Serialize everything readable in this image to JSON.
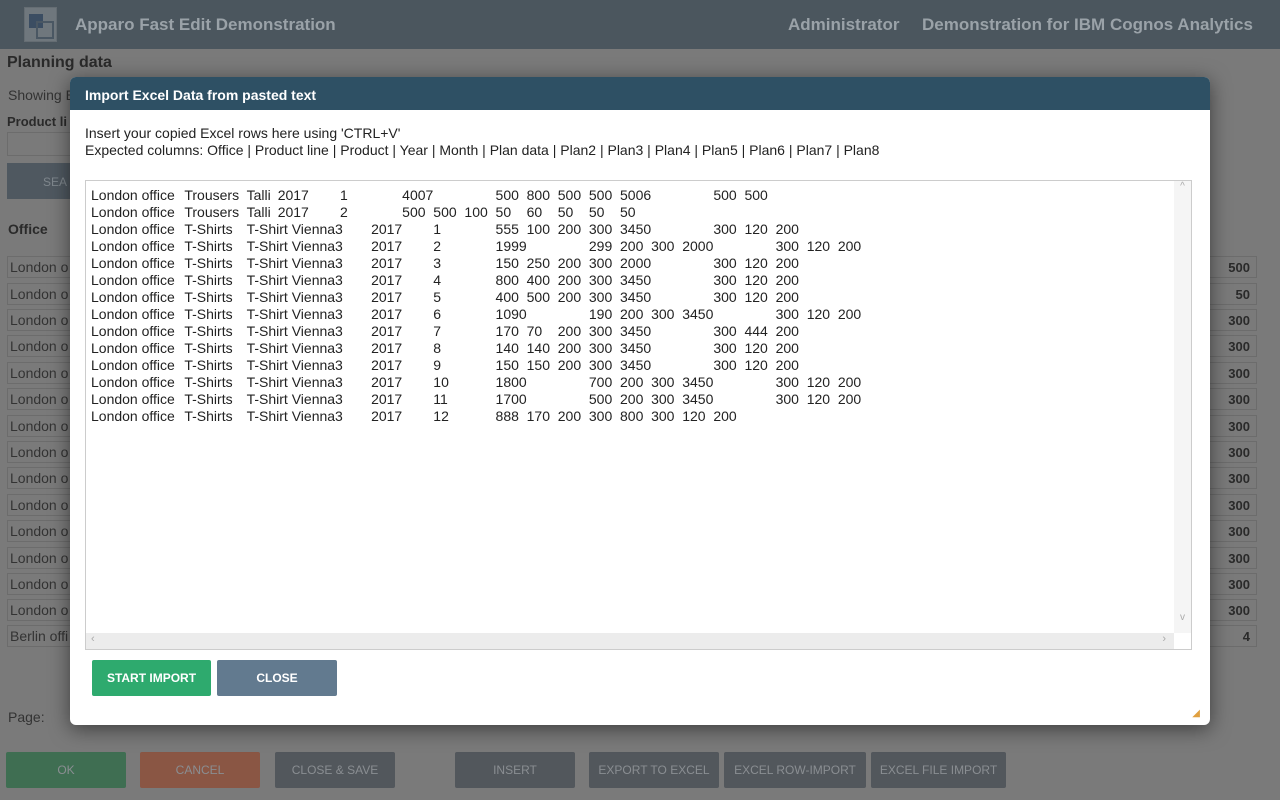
{
  "header": {
    "title": "Apparo Fast Edit Demonstration",
    "user": "Administrator",
    "context": "Demonstration for IBM Cognos Analytics"
  },
  "page": {
    "title": "Planning data",
    "showing": "Showing E",
    "product_line_label": "Product li",
    "search_label": "SEA",
    "office_header": "Office",
    "page_label": "Page:"
  },
  "rows": [
    {
      "office": "London o",
      "value": "500"
    },
    {
      "office": "London o",
      "value": "50"
    },
    {
      "office": "London o",
      "value": "300"
    },
    {
      "office": "London o",
      "value": "300"
    },
    {
      "office": "London o",
      "value": "300"
    },
    {
      "office": "London o",
      "value": "300"
    },
    {
      "office": "London o",
      "value": "300"
    },
    {
      "office": "London o",
      "value": "300"
    },
    {
      "office": "London o",
      "value": "300"
    },
    {
      "office": "London o",
      "value": "300"
    },
    {
      "office": "London o",
      "value": "300"
    },
    {
      "office": "London o",
      "value": "300"
    },
    {
      "office": "London o",
      "value": "300"
    },
    {
      "office": "London o",
      "value": "300"
    },
    {
      "office": "Berlin offi",
      "value": "4"
    }
  ],
  "bottom_buttons": {
    "ok": "OK",
    "cancel": "CANCEL",
    "close_save": "CLOSE & SAVE",
    "insert": "INSERT",
    "export": "EXPORT TO EXCEL",
    "row_import": "EXCEL ROW-IMPORT",
    "file_import": "EXCEL FILE IMPORT"
  },
  "colors": {
    "start": "#2eaa6e",
    "close": "#627a8f",
    "modal_header": "#2e5064"
  },
  "modal": {
    "title": "Import Excel Data from pasted text",
    "instruction": "Insert your copied Excel rows here using 'CTRL+V'",
    "expected": "Expected columns: Office | Product line | Product | Year | Month | Plan data | Plan2 | Plan3 | Plan4 | Plan5 | Plan6 | Plan7 | Plan8",
    "pasted_lines": [
      "London office\tTrousers\tTalli\t2017\t1\t\t4007\t\t500\t800\t500\t500\t5006\t\t500\t500",
      "London office\tTrousers\tTalli\t2017\t2\t\t500\t500\t100\t50\t60\t50\t50\t50",
      "London office\tT-Shirts\tT-Shirt Vienna3\t2017\t1\t\t555\t100\t200\t300\t3450\t\t300\t120\t200",
      "London office\tT-Shirts\tT-Shirt Vienna3\t2017\t2\t\t1999\t\t299\t200\t300\t2000\t\t300\t120\t200",
      "London office\tT-Shirts\tT-Shirt Vienna3\t2017\t3\t\t150\t250\t200\t300\t2000\t\t300\t120\t200",
      "London office\tT-Shirts\tT-Shirt Vienna3\t2017\t4\t\t800\t400\t200\t300\t3450\t\t300\t120\t200",
      "London office\tT-Shirts\tT-Shirt Vienna3\t2017\t5\t\t400\t500\t200\t300\t3450\t\t300\t120\t200",
      "London office\tT-Shirts\tT-Shirt Vienna3\t2017\t6\t\t1090\t\t190\t200\t300\t3450\t\t300\t120\t200",
      "London office\tT-Shirts\tT-Shirt Vienna3\t2017\t7\t\t170\t70\t200\t300\t3450\t\t300\t444\t200",
      "London office\tT-Shirts\tT-Shirt Vienna3\t2017\t8\t\t140\t140\t200\t300\t3450\t\t300\t120\t200",
      "London office\tT-Shirts\tT-Shirt Vienna3\t2017\t9\t\t150\t150\t200\t300\t3450\t\t300\t120\t200",
      "London office\tT-Shirts\tT-Shirt Vienna3\t2017\t10\t\t1800\t\t700\t200\t300\t3450\t\t300\t120\t200",
      "London office\tT-Shirts\tT-Shirt Vienna3\t2017\t11\t\t1700\t\t500\t200\t300\t3450\t\t300\t120\t200",
      "London office\tT-Shirts\tT-Shirt Vienna3\t2017\t12\t\t888\t170\t200\t300\t800\t300\t120\t200"
    ],
    "start_import": "START IMPORT",
    "close": "CLOSE"
  }
}
